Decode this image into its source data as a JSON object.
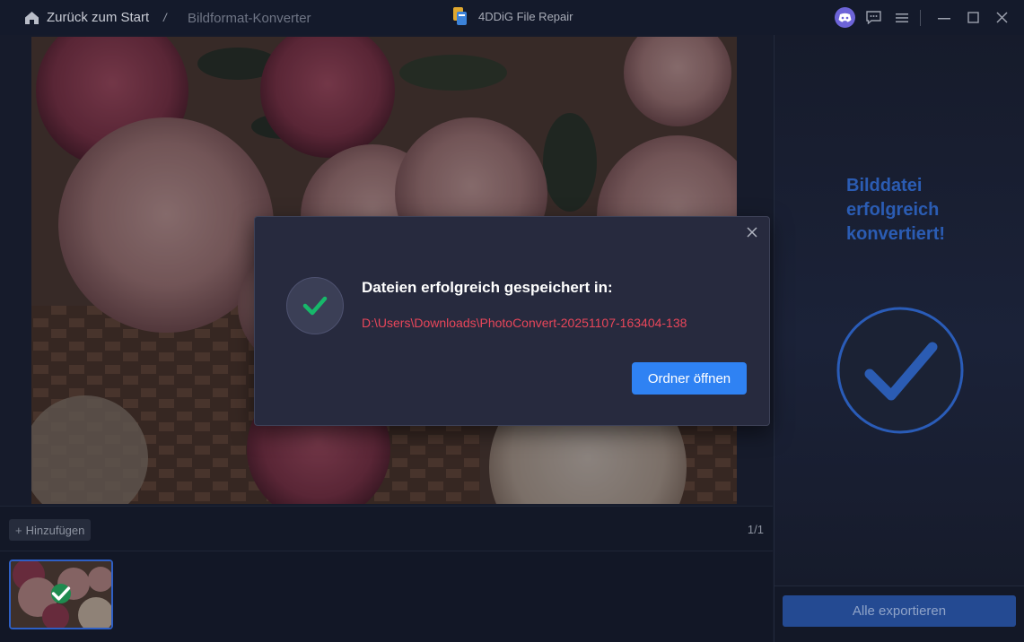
{
  "titlebar": {
    "back_label": "Zurück zum Start",
    "separator": "/",
    "current_page": "Bildformat-Konverter",
    "app_name": "4DDiG File Repair"
  },
  "right_panel": {
    "success_text": "Bilddatei erfolgreich konvertiert!",
    "export_label": "Alle exportieren"
  },
  "toolbar": {
    "add_label": "Hinzufügen",
    "page_count": "1/1"
  },
  "modal": {
    "heading": "Dateien erfolgreich gespeichert in:",
    "path": "D:\\Users\\Downloads\\PhotoConvert-20251107-163404-138",
    "open_folder_label": "Ordner öffnen"
  },
  "colors": {
    "accent_blue": "#2f82f3",
    "success_green": "#1f8a4f",
    "path_red": "#e8465a",
    "headline_blue": "#2b5cb3"
  },
  "icons": [
    "home-icon",
    "app-logo-icon",
    "discord-icon",
    "chat-icon",
    "menu-icon",
    "minimize-icon",
    "maximize-icon",
    "close-icon",
    "check-icon",
    "plus-icon"
  ]
}
